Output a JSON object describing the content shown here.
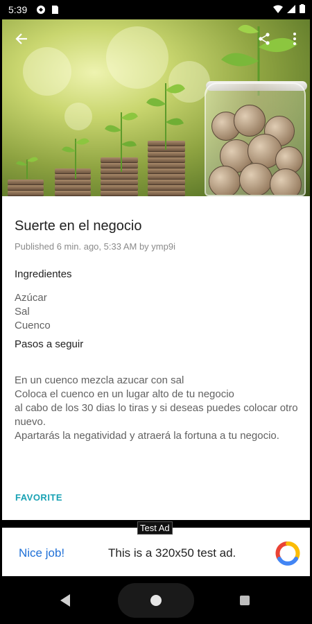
{
  "status_bar": {
    "time": "5:39"
  },
  "post": {
    "title": "Suerte en el negocio",
    "meta": "Published 6 min. ago, 5:33 AM by ymp9i",
    "ingredients_header": "Ingredientes",
    "ingredients": [
      "Azúcar",
      "Sal",
      "Cuenco"
    ],
    "steps_header": "Pasos a seguir",
    "steps": [
      "En un cuenco mezcla azucar con sal",
      "Coloca el cuenco en un lugar alto de tu negocio",
      "al cabo de los 30 dias lo tiras y si deseas puedes colocar otro nuevo.",
      "Apartarás la negatividad y atraerá la fortuna a tu negocio."
    ],
    "favorite_label": "FAVORITE"
  },
  "ad": {
    "label": "Test Ad",
    "nice": "Nice job!",
    "text": "This is a 320x50 test ad."
  },
  "icons": {
    "back": "arrow-left-icon",
    "share": "share-icon",
    "more": "more-vert-icon"
  }
}
